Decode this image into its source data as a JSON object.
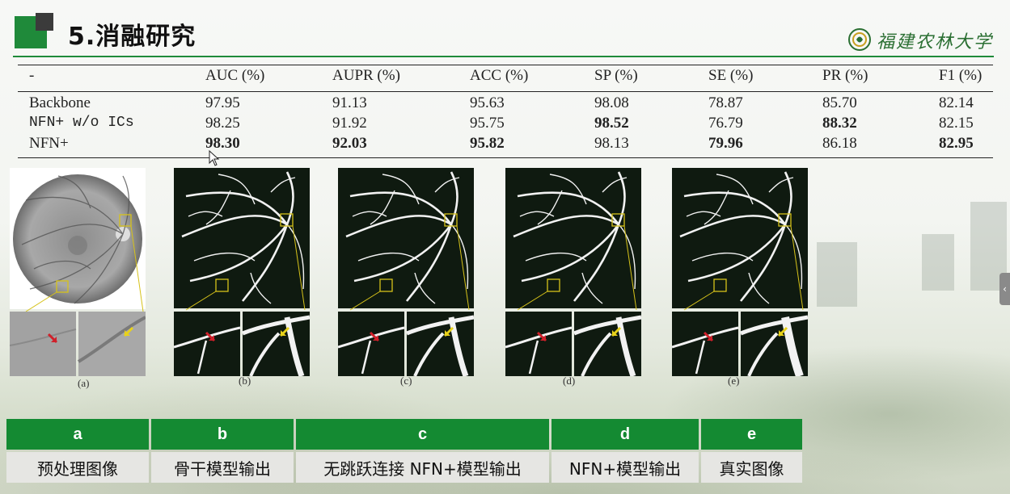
{
  "slide": {
    "title": "5.消融研究",
    "university": "福建农林大学"
  },
  "table": {
    "headers": [
      "-",
      "AUC (%)",
      "AUPR (%)",
      "ACC (%)",
      "SP (%)",
      "SE (%)",
      "PR (%)",
      "F1 (%)"
    ],
    "rows": [
      {
        "name": "Backbone",
        "values": [
          "97.95",
          "91.13",
          "95.63",
          "98.08",
          "78.87",
          "85.70",
          "82.14"
        ],
        "bold": [
          false,
          false,
          false,
          false,
          false,
          false,
          false
        ]
      },
      {
        "name": "NFN+ w/o ICs",
        "values": [
          "98.25",
          "91.92",
          "95.75",
          "98.52",
          "76.79",
          "88.32",
          "82.15"
        ],
        "bold": [
          false,
          false,
          false,
          true,
          false,
          true,
          false
        ]
      },
      {
        "name": "NFN+",
        "values": [
          "98.30",
          "92.03",
          "95.82",
          "98.13",
          "79.96",
          "86.18",
          "82.95"
        ],
        "bold": [
          true,
          true,
          true,
          false,
          true,
          false,
          true
        ]
      }
    ]
  },
  "figure": {
    "captions": [
      "(a)",
      "(b)",
      "(c)",
      "(d)",
      "(e)"
    ]
  },
  "legend": {
    "letters": [
      "a",
      "b",
      "c",
      "d",
      "e"
    ],
    "descriptions": [
      "预处理图像",
      "骨干模型输出",
      "无跳跃连接 NFN+模型输出",
      "NFN+模型输出",
      "真实图像"
    ]
  },
  "colors": {
    "brand_green": "#1f8a3a",
    "legend_header": "#148a32",
    "legend_body": "#e6e6e3",
    "marker_yellow": "#d6c21a",
    "arrow_red": "#d0202a",
    "arrow_yellow": "#e8d21a"
  },
  "icons": [
    "university-logo-icon",
    "collapse-chevron-icon",
    "mouse-cursor-icon"
  ]
}
